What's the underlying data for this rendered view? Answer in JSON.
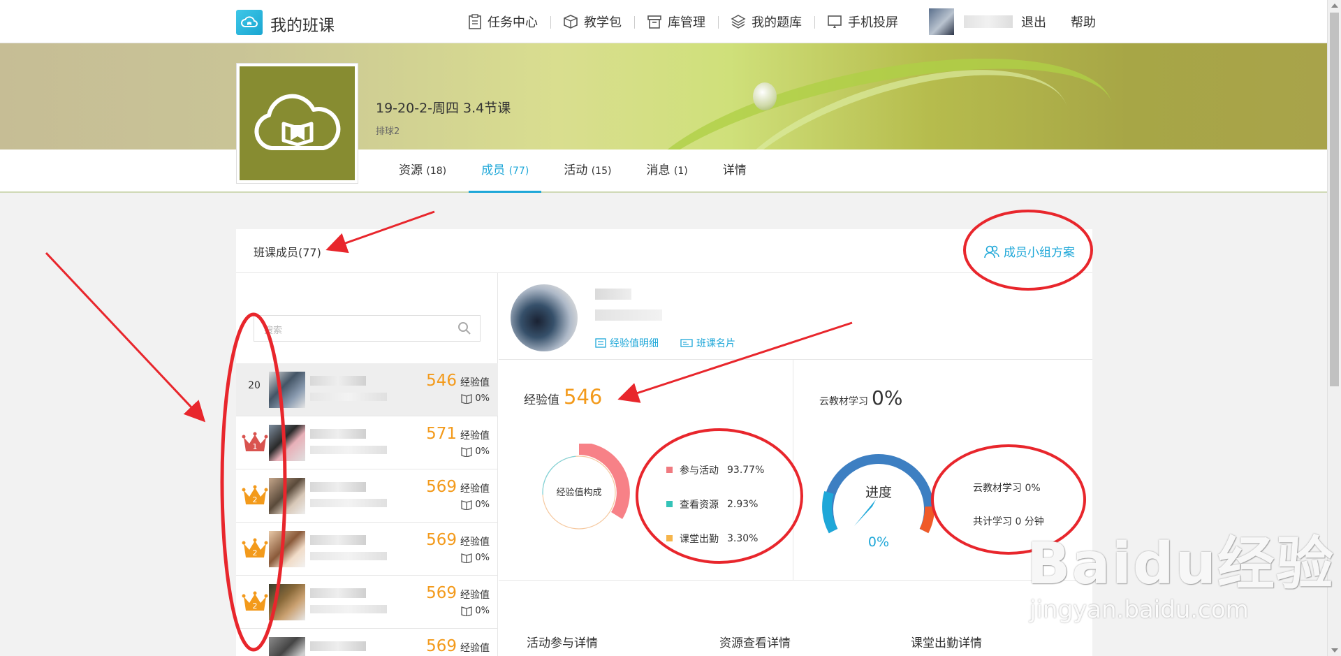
{
  "app": {
    "title": "我的班课"
  },
  "nav": [
    {
      "label": "任务中心",
      "icon": "clipboard-icon"
    },
    {
      "label": "教学包",
      "icon": "package-icon"
    },
    {
      "label": "库管理",
      "icon": "archive-icon"
    },
    {
      "label": "我的题库",
      "icon": "layers-icon"
    },
    {
      "label": "手机投屏",
      "icon": "screen-cast-icon"
    }
  ],
  "user": {
    "logout": "退出",
    "help": "帮助"
  },
  "class": {
    "name": "19-20-2-周四 3.4节课",
    "sub": "排球2"
  },
  "tabs": [
    {
      "label": "资源",
      "count": "(18)"
    },
    {
      "label": "成员",
      "count": "(77)"
    },
    {
      "label": "活动",
      "count": "(15)"
    },
    {
      "label": "消息",
      "count": "(1)"
    },
    {
      "label": "详情",
      "count": ""
    }
  ],
  "panel": {
    "title": "班课成员(77)",
    "group_btn": "成员小组方案"
  },
  "search": {
    "placeholder": "搜索"
  },
  "exp_unit": "经验值",
  "members": [
    {
      "rank": "20",
      "crown": "",
      "score": "546",
      "pct": "0%"
    },
    {
      "rank": "",
      "crown": "1",
      "score": "571",
      "pct": "0%"
    },
    {
      "rank": "",
      "crown": "2",
      "score": "569",
      "pct": "0%"
    },
    {
      "rank": "",
      "crown": "2",
      "score": "569",
      "pct": "0%"
    },
    {
      "rank": "",
      "crown": "2",
      "score": "569",
      "pct": "0%"
    },
    {
      "rank": "",
      "crown": "",
      "score": "569",
      "pct": ""
    }
  ],
  "profile": {
    "exp_detail": "经验值明细",
    "card": "班课名片"
  },
  "exp": {
    "title": "经验值",
    "value": "546",
    "donut_label": "经验值构成",
    "legend": [
      {
        "label": "参与活动",
        "value": "93.77%",
        "color": "#f07a80"
      },
      {
        "label": "查看资源",
        "value": "2.93%",
        "color": "#34c3b8"
      },
      {
        "label": "课堂出勤",
        "value": "3.30%",
        "color": "#f6b54b"
      }
    ]
  },
  "cloud": {
    "title": "云教材学习",
    "value": "0%",
    "gauge_label": "进度",
    "gauge_value": "0%",
    "info1": "云教材学习 0%",
    "info2": "共计学习 0 分钟"
  },
  "details": [
    {
      "label": "活动参与详情"
    },
    {
      "label": "资源查看详情"
    },
    {
      "label": "课堂出勤详情"
    }
  ],
  "watermark": {
    "brand": "Bai",
    "brand2": "du",
    "suffix": "经验",
    "url": "jingyan.baidu.com"
  }
}
